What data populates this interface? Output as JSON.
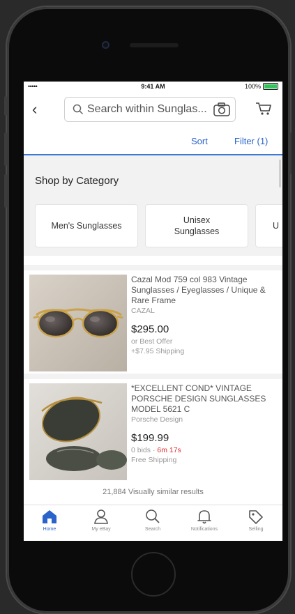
{
  "status_bar": {
    "signal": "•••••",
    "time": "9:41 AM",
    "battery_text": "100%"
  },
  "header": {
    "search_placeholder": "Search within Sunglas..."
  },
  "controls": {
    "sort_label": "Sort",
    "filter_label": "Filter (1)"
  },
  "category": {
    "title": "Shop by Category",
    "chips": [
      {
        "label": "Men's Sunglasses"
      },
      {
        "label": "Unisex Sunglasses"
      },
      {
        "label": "U"
      }
    ]
  },
  "listings": [
    {
      "title": "Cazal Mod 759 col 983 Vintage Sunglasses / Eyeglasses / Unique & Rare Frame",
      "seller": "CAZAL",
      "price": "$295.00",
      "sub": "or Best Offer",
      "shipping": "+$7.95 Shipping"
    },
    {
      "title": "*EXCELLENT COND* VINTAGE PORSCHE DESIGN SUNGLASSES MODEL 5621 C",
      "seller": "Porsche Design",
      "price": "$199.99",
      "bids": "0 bids",
      "time_left": "6m 17s",
      "shipping": "Free Shipping"
    }
  ],
  "similar_text": "21,884 Visually similar results",
  "tabs": [
    {
      "label": "Home",
      "icon": "home-icon"
    },
    {
      "label": "My eBay",
      "icon": "person-icon"
    },
    {
      "label": "Search",
      "icon": "search-icon"
    },
    {
      "label": "Notifications",
      "icon": "bell-icon"
    },
    {
      "label": "Selling",
      "icon": "tag-icon"
    }
  ],
  "colors": {
    "accent": "#2a63c9",
    "battery": "#37c35c",
    "countdown": "#e02b2b"
  }
}
